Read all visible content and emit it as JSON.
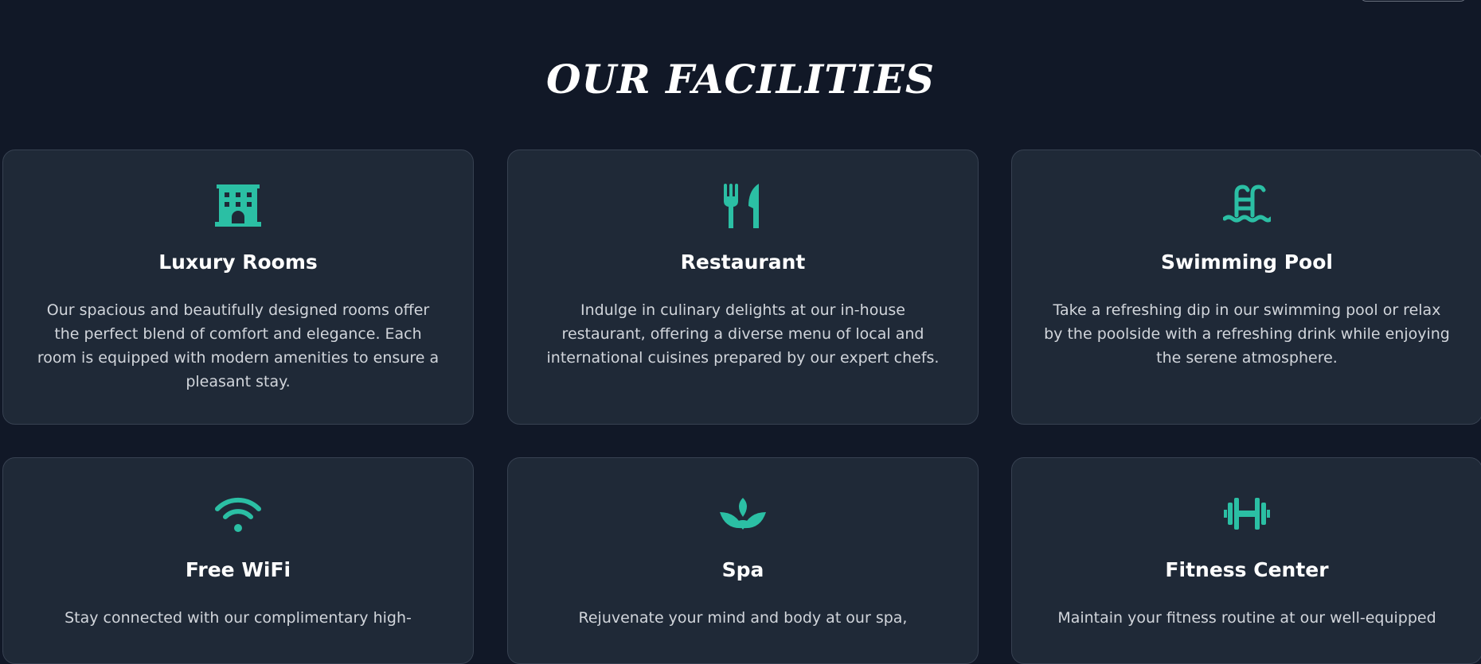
{
  "section": {
    "title": "OUR FACILITIES"
  },
  "theme": {
    "background": "#111827",
    "card_background": "#1f2937",
    "card_border": "#374151",
    "accent": "#2bbfa4",
    "title_color": "#ffffff",
    "text_color": "#d1d5db"
  },
  "facilities": [
    {
      "icon": "hotel-building-icon",
      "title": "Luxury Rooms",
      "description": "Our spacious and beautifully designed rooms offer the perfect blend of comfort and elegance. Each room is equipped with modern amenities to ensure a pleasant stay."
    },
    {
      "icon": "fork-knife-icon",
      "title": "Restaurant",
      "description": "Indulge in culinary delights at our in-house restaurant, offering a diverse menu of local and international cuisines prepared by our expert chefs."
    },
    {
      "icon": "swimming-pool-icon",
      "title": "Swimming Pool",
      "description": "Take a refreshing dip in our swimming pool or relax by the poolside with a refreshing drink while enjoying the serene atmosphere."
    },
    {
      "icon": "wifi-icon",
      "title": "Free WiFi",
      "description": "Stay connected with our complimentary high-"
    },
    {
      "icon": "spa-lotus-icon",
      "title": "Spa",
      "description": "Rejuvenate your mind and body at our spa,"
    },
    {
      "icon": "dumbbell-icon",
      "title": "Fitness Center",
      "description": "Maintain your fitness routine at our well-equipped"
    }
  ]
}
